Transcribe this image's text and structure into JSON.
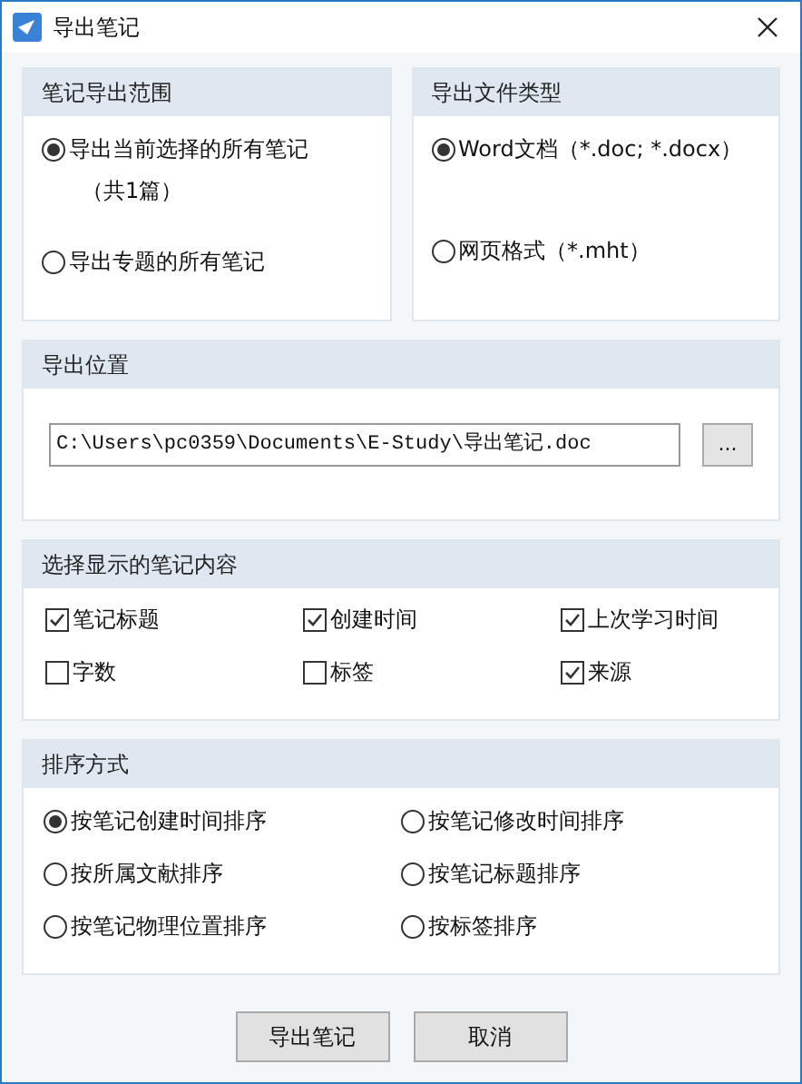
{
  "window": {
    "title": "导出笔记"
  },
  "range": {
    "title": "笔记导出范围",
    "options": [
      {
        "label": "导出当前选择的所有笔记",
        "note": "（共1篇）",
        "selected": true
      },
      {
        "label": "导出专题的所有笔记",
        "selected": false
      }
    ]
  },
  "file_type": {
    "title": "导出文件类型",
    "options": [
      {
        "label": "Word文档（*.doc; *.docx）",
        "selected": true
      },
      {
        "label": "网页格式（*.mht）",
        "selected": false
      }
    ]
  },
  "location": {
    "title": "导出位置",
    "path": "C:\\Users\\pc0359\\Documents\\E-Study\\导出笔记.doc",
    "browse": "..."
  },
  "content": {
    "title": "选择显示的笔记内容",
    "items": [
      {
        "label": "笔记标题",
        "checked": true
      },
      {
        "label": "创建时间",
        "checked": true
      },
      {
        "label": "上次学习时间",
        "checked": true
      },
      {
        "label": "字数",
        "checked": false
      },
      {
        "label": "标签",
        "checked": false
      },
      {
        "label": "来源",
        "checked": true
      }
    ]
  },
  "sort": {
    "title": "排序方式",
    "options": [
      {
        "label": "按笔记创建时间排序",
        "selected": true
      },
      {
        "label": "按笔记修改时间排序",
        "selected": false
      },
      {
        "label": "按所属文献排序",
        "selected": false
      },
      {
        "label": "按笔记标题排序",
        "selected": false
      },
      {
        "label": "按笔记物理位置排序",
        "selected": false
      },
      {
        "label": "按标签排序",
        "selected": false
      }
    ]
  },
  "buttons": [
    "导出笔记",
    "取消"
  ]
}
